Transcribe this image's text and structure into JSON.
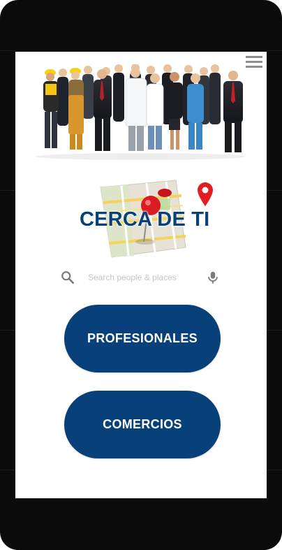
{
  "app": {
    "title": "CERCA DE TI"
  },
  "header": {
    "menu_icon": "hamburger-menu-icon"
  },
  "search": {
    "placeholder": "Search people & places",
    "value": "",
    "icon": "search-icon",
    "voice_icon": "microphone-icon"
  },
  "buttons": {
    "professionals": "PROFESIONALES",
    "businesses": "COMERCIOS"
  },
  "colors": {
    "brand_blue": "#08407a",
    "phone_frame": "#0b0b0b",
    "pin_red": "#e31b23"
  }
}
